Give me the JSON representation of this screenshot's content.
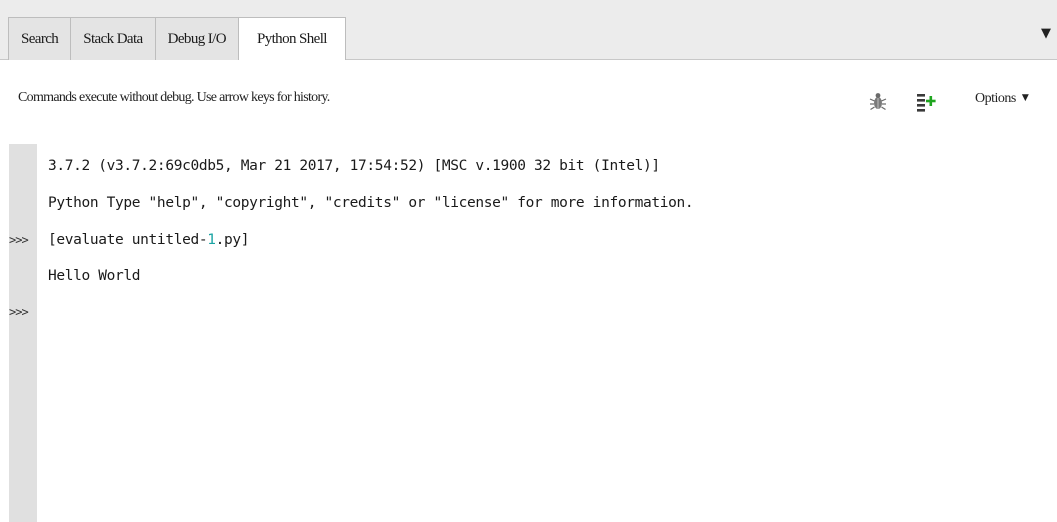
{
  "tabs": [
    {
      "label": "Search",
      "active": false
    },
    {
      "label": "Stack Data",
      "active": false
    },
    {
      "label": "Debug I/O",
      "active": false
    },
    {
      "label": "Python Shell",
      "active": true
    }
  ],
  "tab_menu_icon": "triangle-down-icon",
  "info_bar": {
    "text": "Commands execute without debug.  Use arrow keys for history.",
    "icons": [
      "bug-icon",
      "add-lines-icon"
    ],
    "options_label": "Options"
  },
  "shell": {
    "banner_line_1": "3.7.2 (v3.7.2:69c0db5, Mar 21 2017, 17:54:52) [MSC v.1900 32 bit (Intel)]",
    "banner_line_2": "Python Type \"help\", \"copyright\", \"credits\" or \"license\" for more information.",
    "prompt": ">>>",
    "command_prefix": "[evaluate untitled-",
    "command_number": "1",
    "command_suffix": ".py]",
    "output": "Hello World"
  },
  "colors": {
    "tab_strip_bg": "#ececec",
    "gutter_bg": "#e0e0e0",
    "number_literal": "#1aa3a3",
    "add_icon_green": "#1fa51f"
  }
}
